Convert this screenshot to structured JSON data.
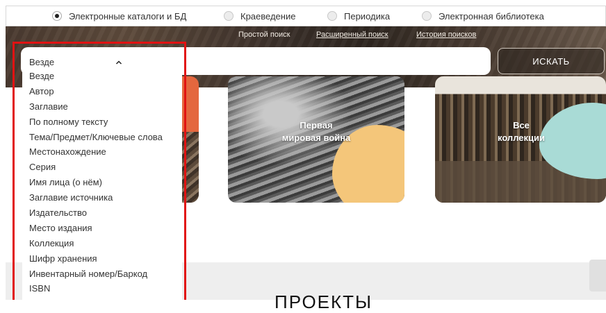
{
  "search_modes": [
    {
      "label": "Электронные каталоги и БД",
      "selected": true
    },
    {
      "label": "Краеведение",
      "selected": false
    },
    {
      "label": "Периодика",
      "selected": false
    },
    {
      "label": "Электронная библиотека",
      "selected": false
    }
  ],
  "search_links": {
    "simple": "Простой поиск",
    "advanced": "Расширенный поиск",
    "history": "История поисков"
  },
  "search_button": "ИСКАТЬ",
  "field_dropdown": {
    "selected": "Везде",
    "chevron_icon": "chevron-up-icon",
    "options": [
      "Везде",
      "Автор",
      "Заглавие",
      "По полному тексту",
      "Тема/Предмет/Ключевые слова",
      "Местонахождение",
      "Серия",
      "Имя лица (о нём)",
      "Заглавие источника",
      "Издательство",
      "Место издания",
      "Коллекция",
      "Шифр хранения",
      "Инвентарный номер/Баркод",
      "ISBN"
    ]
  },
  "cards": {
    "war": {
      "line1": "Первая",
      "line2": "мировая война"
    },
    "collections": {
      "line1": "Все",
      "line2": "коллекции"
    }
  },
  "section_heading": "ПРОЕКТЫ",
  "colors": {
    "highlight_border": "#e11212",
    "orange_accent": "#e4673e",
    "yellow_blob": "#f4c67a",
    "teal_blob": "#a9dbd6"
  }
}
